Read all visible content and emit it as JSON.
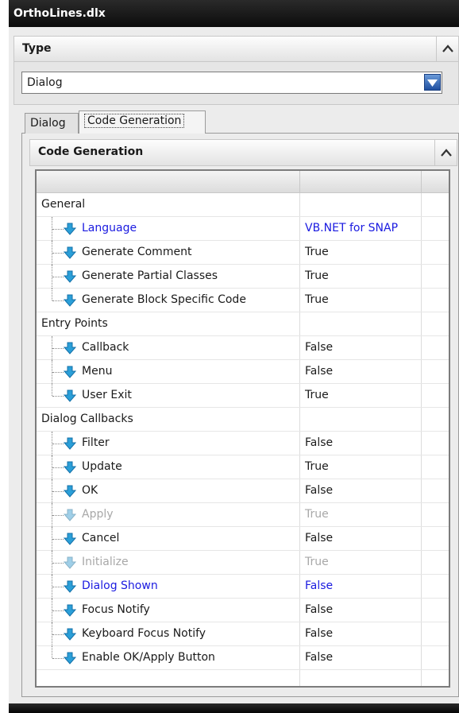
{
  "window": {
    "title": "OrthoLines.dlx"
  },
  "type_section": {
    "header": "Type",
    "collapse_glyph": "^",
    "select_value": "Dialog"
  },
  "tabs": [
    {
      "label": "Dialog",
      "active": false
    },
    {
      "label": "Code Generation",
      "active": true
    }
  ],
  "code_generation": {
    "header": "Code Generation",
    "collapse_glyph": "^",
    "groups": [
      {
        "label": "General",
        "items": [
          {
            "name": "Language",
            "value": "VB.NET for SNAP",
            "style": "blue"
          },
          {
            "name": "Generate Comment",
            "value": "True",
            "style": "normal"
          },
          {
            "name": "Generate Partial Classes",
            "value": "True",
            "style": "normal"
          },
          {
            "name": "Generate Block Specific Code",
            "value": "True",
            "style": "normal"
          }
        ]
      },
      {
        "label": "Entry Points",
        "items": [
          {
            "name": "Callback",
            "value": "False",
            "style": "normal"
          },
          {
            "name": "Menu",
            "value": "False",
            "style": "normal"
          },
          {
            "name": "User Exit",
            "value": "True",
            "style": "normal"
          }
        ]
      },
      {
        "label": "Dialog Callbacks",
        "items": [
          {
            "name": "Filter",
            "value": "False",
            "style": "normal"
          },
          {
            "name": "Update",
            "value": "True",
            "style": "normal"
          },
          {
            "name": "OK",
            "value": "False",
            "style": "normal"
          },
          {
            "name": "Apply",
            "value": "True",
            "style": "gray"
          },
          {
            "name": "Cancel",
            "value": "False",
            "style": "normal"
          },
          {
            "name": "Initialize",
            "value": "True",
            "style": "gray"
          },
          {
            "name": "Dialog Shown",
            "value": "False",
            "style": "blue"
          },
          {
            "name": "Focus Notify",
            "value": "False",
            "style": "normal"
          },
          {
            "name": "Keyboard Focus Notify",
            "value": "False",
            "style": "normal"
          },
          {
            "name": "Enable OK/Apply Button",
            "value": "False",
            "style": "normal"
          }
        ]
      }
    ]
  },
  "colors": {
    "link_blue": "#1a1ae0",
    "disabled_gray": "#a8a8a8",
    "icon_teal": "#2a9fd8"
  },
  "icons": {
    "select_arrow": "dropdown-arrow-icon",
    "item": "blue-down-arrow-icon",
    "collapse": "chevron-up-icon"
  }
}
